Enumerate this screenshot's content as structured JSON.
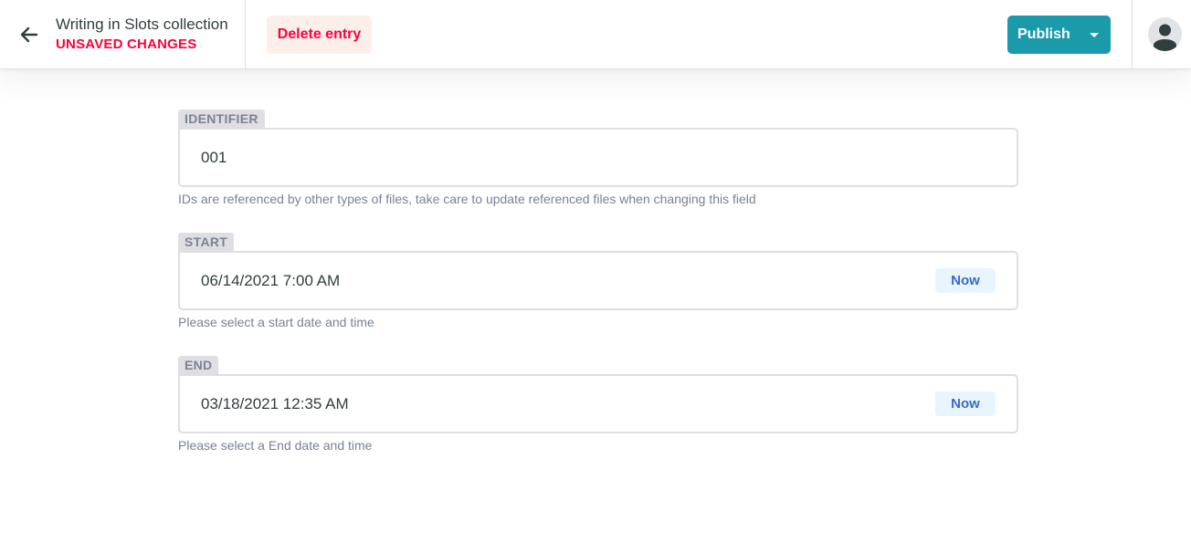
{
  "header": {
    "back_icon": "arrow-left-icon",
    "entry_title": "Writing in Slots collection",
    "status": "UNSAVED CHANGES",
    "delete_label": "Delete entry",
    "publish_label": "Publish",
    "publish_dropdown_icon": "caret-down-icon",
    "avatar_icon": "user-avatar-icon"
  },
  "colors": {
    "danger": "#ff003b",
    "primary": "#1b9aaa",
    "now_text": "#3a69c7"
  },
  "fields": [
    {
      "label": "IDENTIFIER",
      "value": "001",
      "hint": "IDs are referenced by other types of files, take care to update referenced files when changing this field"
    },
    {
      "label": "START",
      "value": "06/14/2021 7:00 AM",
      "now_label": "Now",
      "hint": "Please select a start date and time"
    },
    {
      "label": "END",
      "value": "03/18/2021 12:35 AM",
      "now_label": "Now",
      "hint": "Please select a End date and time"
    }
  ]
}
